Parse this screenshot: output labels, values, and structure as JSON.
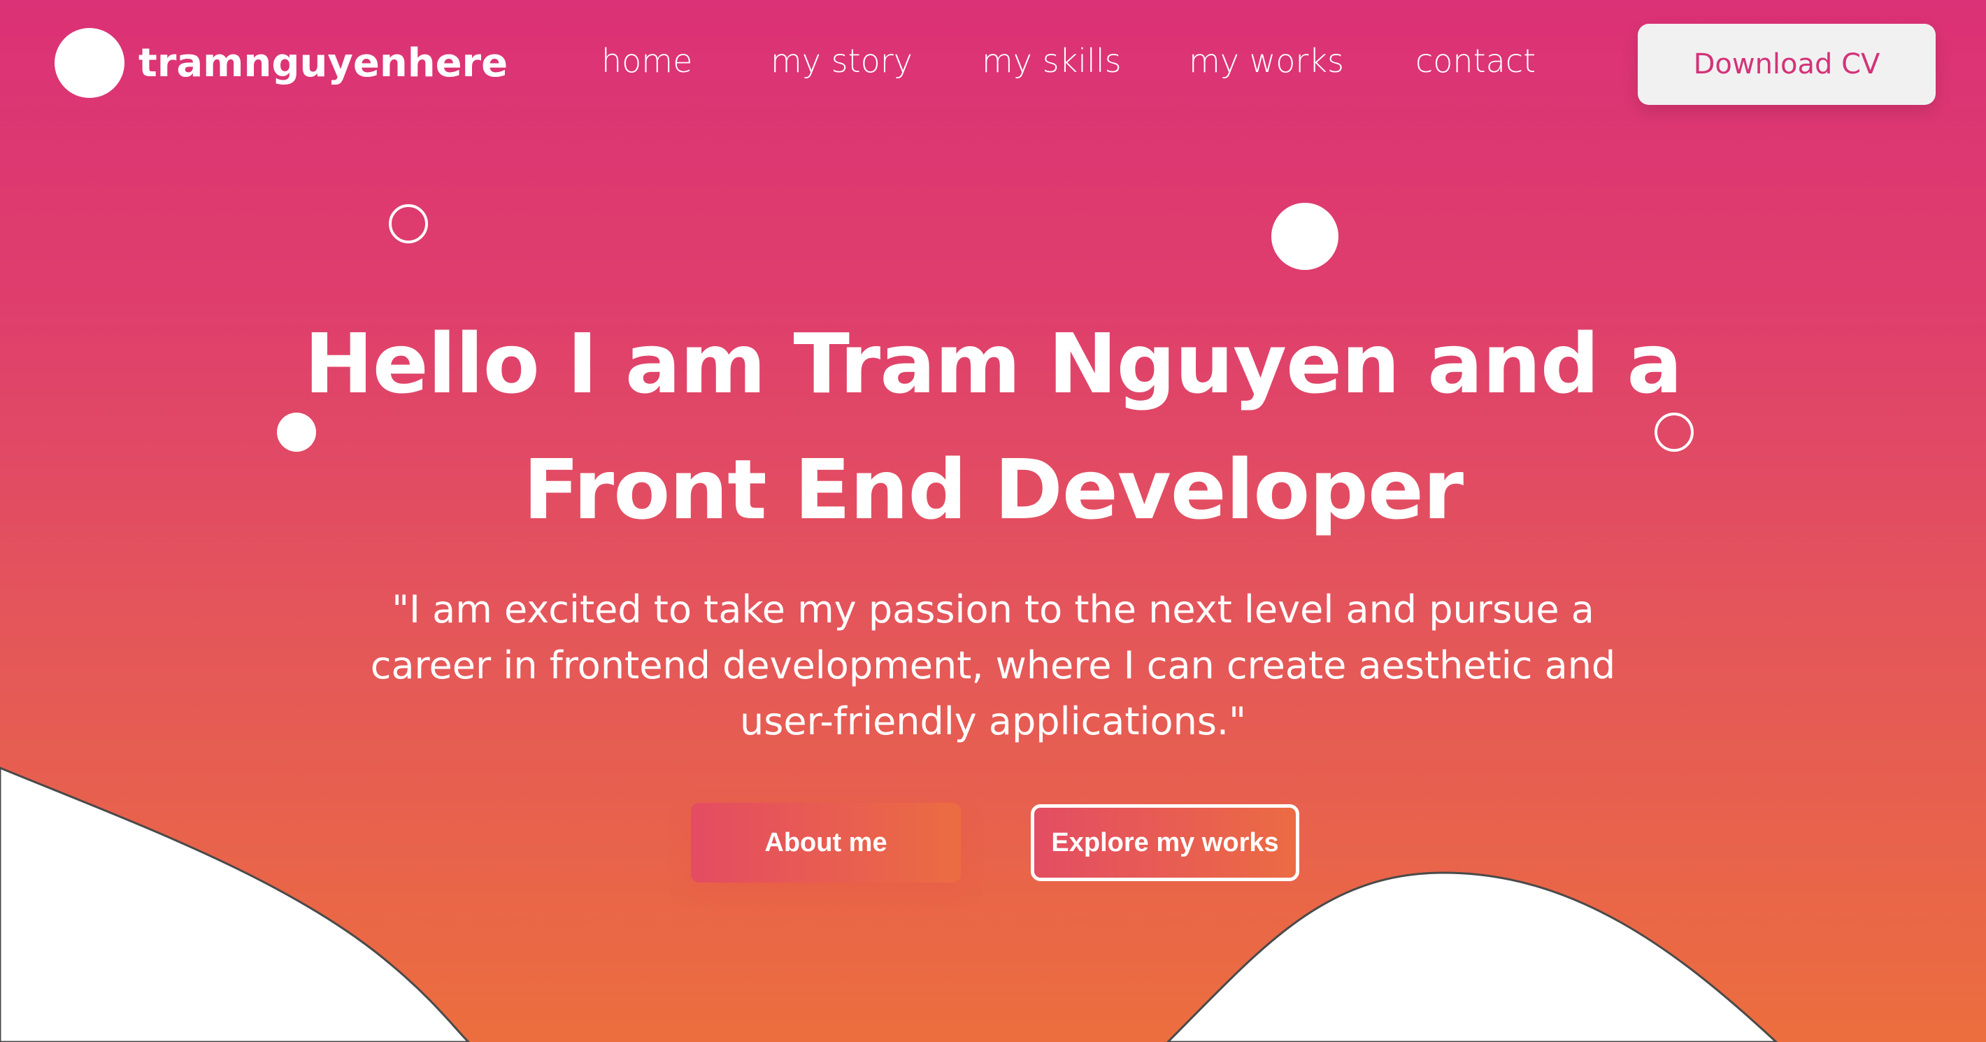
{
  "header": {
    "logo_text": "tramnguyenhere",
    "nav": [
      {
        "label": "home"
      },
      {
        "label": "my story"
      },
      {
        "label": "my skills"
      },
      {
        "label": "my works"
      },
      {
        "label": "contact"
      }
    ],
    "download_label": "Download CV"
  },
  "hero": {
    "title_line1": "Hello I am Tram Nguyen and a",
    "title_line2": "Front End Developer",
    "quote_line1": "\"I am excited to take my passion to the next level and pursue a",
    "quote_line2": "career in frontend development, where I can create aesthetic and",
    "quote_line3": "user-friendly applications.\"",
    "about_label": "About me",
    "explore_label": "Explore my works"
  },
  "colors": {
    "gradient_top": "#db3176",
    "gradient_bottom": "#ec6e3e",
    "accent_text": "#d33378",
    "white": "#ffffff"
  }
}
